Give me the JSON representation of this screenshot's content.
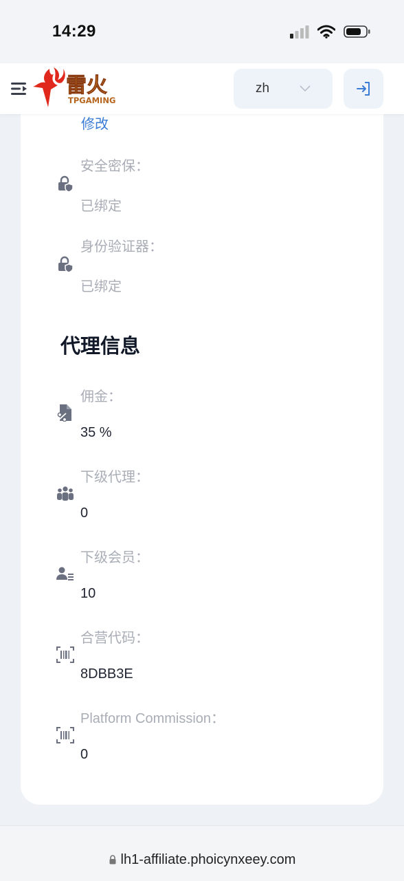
{
  "status_bar": {
    "time": "14:29"
  },
  "header": {
    "logo_text": "雷火",
    "logo_subtext": "TPGAMING",
    "language": "zh"
  },
  "security": {
    "modify_label": "修改",
    "items": [
      {
        "label": "安全密保：",
        "value": "已绑定",
        "icon": "lock-shield-icon"
      },
      {
        "label": "身份验证器：",
        "value": "已绑定",
        "icon": "lock-shield-icon"
      }
    ]
  },
  "agent_info": {
    "title": "代理信息",
    "items": [
      {
        "label": "佣金：",
        "value": "35 %",
        "icon": "percent-document-icon"
      },
      {
        "label": "下级代理：",
        "value": "0",
        "icon": "users-icon"
      },
      {
        "label": "下级会员：",
        "value": "10",
        "icon": "member-list-icon"
      },
      {
        "label": "合营代码：",
        "value": "8DBB3E",
        "icon": "barcode-icon"
      },
      {
        "label": "Platform Commission：",
        "value": "0",
        "icon": "barcode-icon"
      }
    ]
  },
  "browser": {
    "url": "lh1-affiliate.phoicynxeey.com"
  },
  "colors": {
    "accent": "#3a7bd5",
    "label": "#a9adb6",
    "logo_red": "#e0291c",
    "logo_gold": "#d99a2b"
  }
}
